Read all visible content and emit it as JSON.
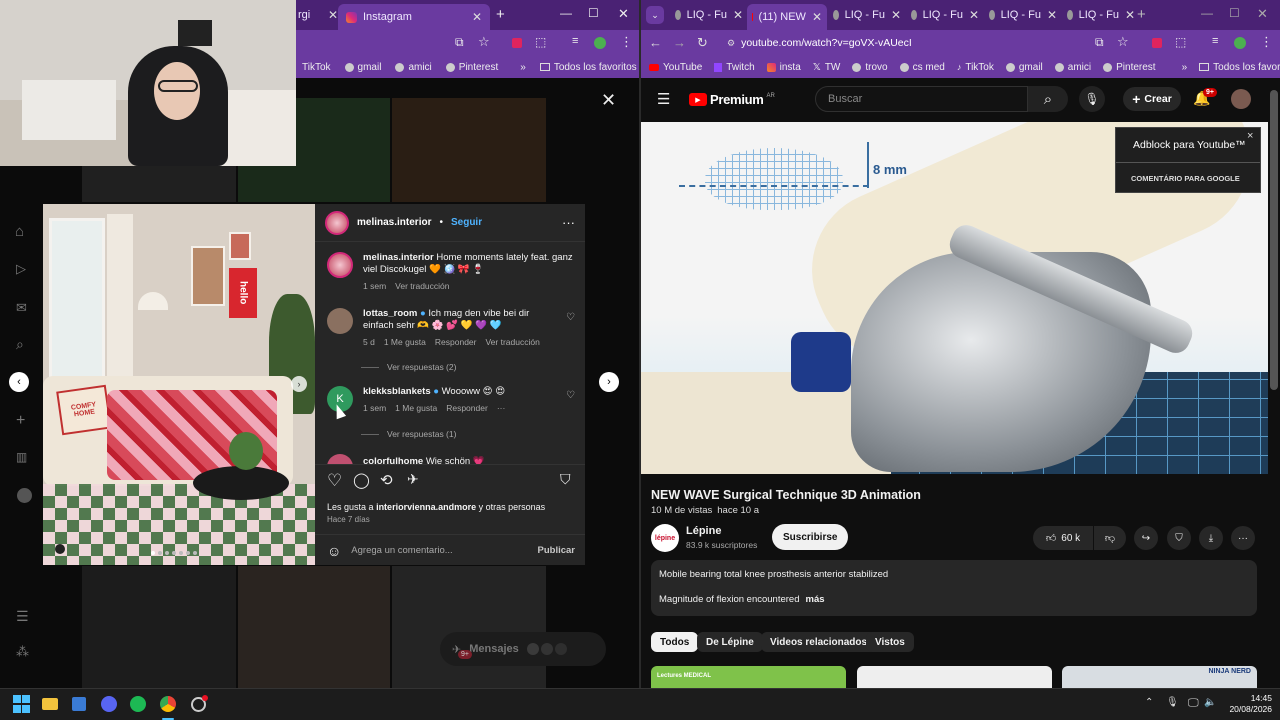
{
  "left_browser": {
    "tabs": [
      {
        "label": "rgi"
      },
      {
        "label": "Instagram"
      }
    ],
    "bookmarks": [
      "TikTok",
      "gmail",
      "amici",
      "Pinterest",
      "Todos los favoritos"
    ]
  },
  "right_browser": {
    "tabs": [
      "LIQ - Fu",
      "(11) NEW",
      "LIQ - Fu",
      "LIQ - Fu",
      "LIQ - Fu",
      "LIQ - Fu"
    ],
    "url": "youtube.com/watch?v=goVX-vAUecI",
    "bookmarks": [
      "YouTube",
      "Twitch",
      "insta",
      "TW",
      "trovo",
      "cs med",
      "TikTok",
      "gmail",
      "amici",
      "Pinterest",
      "Todos los favoritos"
    ]
  },
  "instagram": {
    "post_author": "melinas.interior",
    "follow_label": "Seguir",
    "caption": {
      "user": "melinas.interior",
      "text": "Home moments lately feat. ganz viel Discokugel 🧡 🪩 🎀 🍷",
      "time": "1 sem",
      "translate": "Ver traducción"
    },
    "comments": [
      {
        "user": "lottas_room",
        "text": "Ich mag den vibe bei dir einfach sehr 🫶 🌸 💕 💛 💜 🩵",
        "time": "5 d",
        "likes": "1 Me gusta",
        "reply": "Responder",
        "translate": "Ver traducción",
        "replies": "Ver respuestas (2)"
      },
      {
        "user": "klekksblankets",
        "text": "Woooww 😍 😍",
        "time": "1 sem",
        "likes": "1 Me gusta",
        "reply": "Responder",
        "more": "···",
        "replies": "Ver respuestas (1)"
      },
      {
        "user": "colorfulhome",
        "text": "Wie schön 💗"
      }
    ],
    "likes_text_prefix": "Les gusta a",
    "likes_user": "interiorvienna.andmore",
    "likes_text_suffix": "y otras personas",
    "date": "Hace 7 días",
    "comment_placeholder": "Agrega un comentario...",
    "publish_label": "Publicar",
    "messages_label": "Mensajes",
    "messages_badge": "9+",
    "frame_sign": "hello",
    "pillow_text": "COMFY HOME"
  },
  "youtube": {
    "logo": "Premium",
    "logo_region": "AR",
    "search_placeholder": "Buscar",
    "create_label": "Crear",
    "notif_badge": "9+",
    "video_label": "8 mm",
    "title": "NEW WAVE Surgical Technique 3D Animation",
    "views": "10 M de vistas",
    "age": "hace 10 a",
    "channel": "Lépine",
    "subscribers": "83.9 k suscriptores",
    "subscribe": "Suscribirse",
    "likes": "60 k",
    "desc_line1": "Mobile bearing total knee prosthesis anterior stabilized",
    "desc_line2": "Magnitude of flexion encountered",
    "more": "más",
    "chips": [
      "Todos",
      "De Lépine",
      "Videos relacionados",
      "Vistos"
    ],
    "thumb1_text": "Lectures MEDICAL",
    "thumb3_text": "NINJA NERD"
  },
  "adblock": {
    "title": "Adblock para Youtube™",
    "subtitle": "COMENTÁRIO PARA GOOGLE",
    "close": "×"
  },
  "taskbar": {
    "time": "14:45",
    "date": "20/08/2026"
  },
  "colors": {
    "browser_purple": "#5b2d8e",
    "ig_panel": "#262626",
    "yt_bg": "#0f0f0f",
    "ig_blue": "#4fb3ff"
  }
}
